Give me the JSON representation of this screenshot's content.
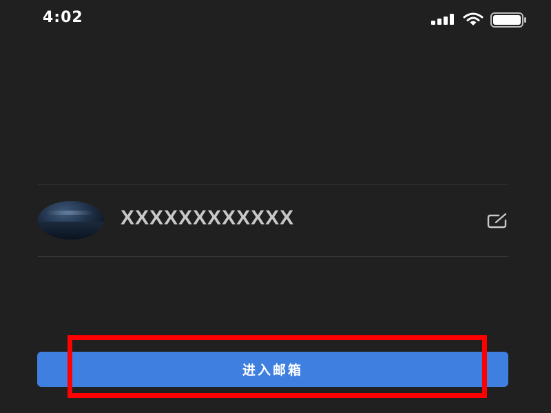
{
  "status_bar": {
    "time": "4:02",
    "signal_icon": "cellular-signal-icon",
    "wifi_icon": "wifi-icon",
    "battery_icon": "battery-icon"
  },
  "account": {
    "avatar": "avatar-image",
    "name": "XXXXXXXXXXXX",
    "edit_icon": "edit-icon"
  },
  "actions": {
    "enter_mailbox_label": "进入邮箱"
  },
  "colors": {
    "background": "#202020",
    "divider": "#3a3a3a",
    "primary_button": "#3f7fe0",
    "highlight": "#ff0000",
    "account_text": "#c9c9c9"
  }
}
